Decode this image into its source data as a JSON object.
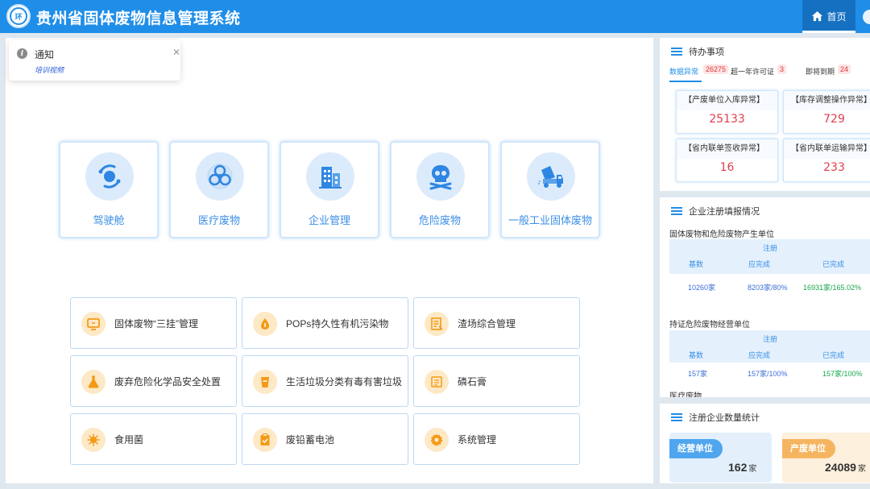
{
  "header": {
    "title": "贵州省固体废物信息管理系统",
    "home_tab": "首页",
    "logo_text": "环"
  },
  "notice": {
    "title": "通知",
    "link": "培训视频"
  },
  "modules": [
    {
      "label": "驾驶舱",
      "icon": "cockpit-icon"
    },
    {
      "label": "医疗废物",
      "icon": "biohazard-icon"
    },
    {
      "label": "企业管理",
      "icon": "building-icon"
    },
    {
      "label": "危险废物",
      "icon": "skull-icon"
    },
    {
      "label": "一般工业固体废物",
      "icon": "dump-truck-icon"
    }
  ],
  "functions": [
    {
      "label": "固体废物“三挂”管理",
      "icon": "monitor-icon"
    },
    {
      "label": "POPs持久性有机污染物",
      "icon": "drop-icon"
    },
    {
      "label": "渣场综合管理",
      "icon": "document-icon"
    },
    {
      "label": "废弃危险化学品安全处置",
      "icon": "flask-icon"
    },
    {
      "label": "生活垃圾分类有毒有害垃圾",
      "icon": "cup-icon"
    },
    {
      "label": "磷石膏",
      "icon": "list-icon"
    },
    {
      "label": "食用菌",
      "icon": "virus-icon"
    },
    {
      "label": "废铅蓄电池",
      "icon": "clipboard-icon"
    },
    {
      "label": "系统管理",
      "icon": "gear-icon"
    }
  ],
  "todo": {
    "title": "待办事项",
    "tabs": [
      {
        "label": "数据异常",
        "badge": "26275"
      },
      {
        "label": "超一年许可证",
        "badge": "3"
      },
      {
        "label": "即将到期",
        "badge": "24"
      }
    ],
    "stats": [
      {
        "label": "【产废单位入库异常】",
        "value": "25133"
      },
      {
        "label": "【库存调整操作异常】",
        "value": "729"
      },
      {
        "label": "【省内联单签收异常】",
        "value": "16"
      },
      {
        "label": "【省内联单运输异常】",
        "value": "233"
      }
    ]
  },
  "registration": {
    "title": "企业注册填报情况",
    "groups": [
      {
        "subtitle": "固体废物和危险废物产生单位",
        "header": "注册",
        "cols": [
          "基数",
          "应完成",
          "已完成"
        ],
        "row": [
          "10260家",
          "8203家/80%",
          "16931家/165.02%"
        ]
      },
      {
        "subtitle": "持证危险废物经营单位",
        "header": "注册",
        "cols": [
          "基数",
          "应完成",
          "已完成"
        ],
        "row": [
          "157家",
          "157家/100%",
          "157家/100%"
        ]
      }
    ],
    "cut_text": "医疗废物"
  },
  "counts": {
    "title": "注册企业数量统计",
    "items": [
      {
        "tag": "经营单位",
        "value": "162",
        "unit": "家"
      },
      {
        "tag": "产废单位",
        "value": "24089",
        "unit": "家"
      }
    ]
  },
  "colors": {
    "primary": "#1f8ee8",
    "alert_red": "#e0404e",
    "success_green": "#17a84b",
    "icon_orange": "#f39a16"
  }
}
